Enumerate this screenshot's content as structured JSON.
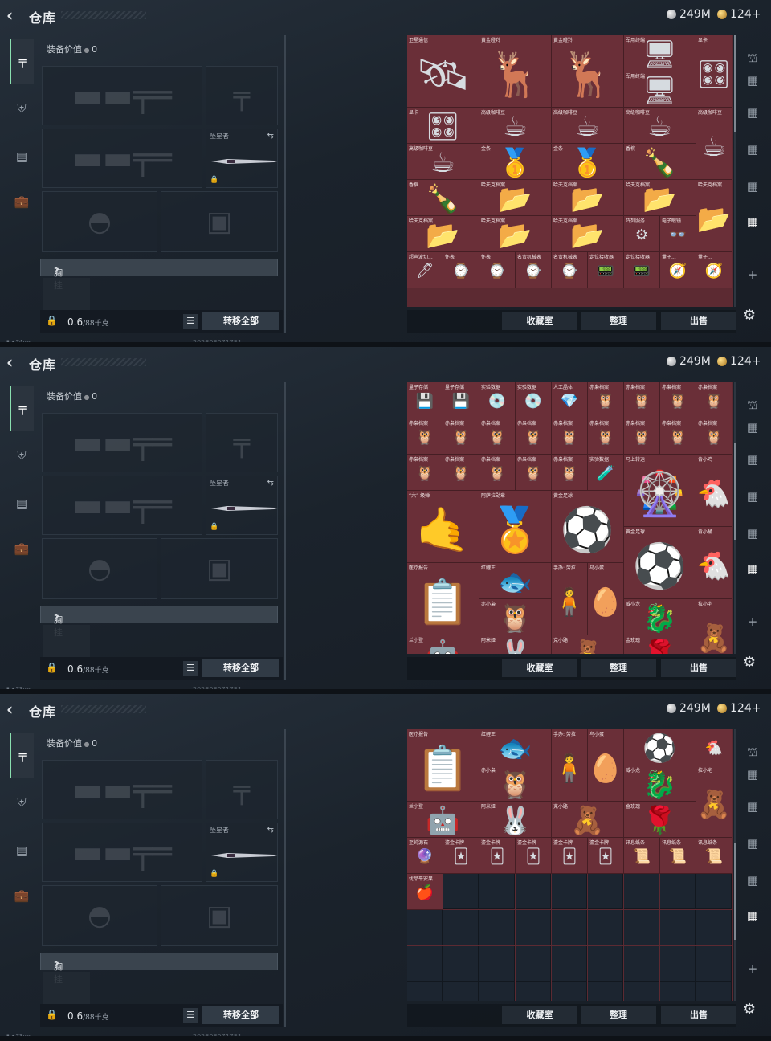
{
  "header": {
    "title": "仓库",
    "silver": "249M",
    "gold": "124+"
  },
  "sidebar": {
    "icons": [
      "pistol-icon",
      "armor-icon",
      "backpack-icon",
      "briefcase-icon"
    ]
  },
  "left_panel": {
    "equip_value_label": "装备价值",
    "equip_value": "0",
    "melee_label": "坠星者",
    "chest_label": "胸挂",
    "chest_help": "?",
    "weight": "0.6",
    "weight_max": "/88千克",
    "transfer_all": "转移全部"
  },
  "buttons": {
    "collection": "收藏室",
    "sort": "整理",
    "sell": "出售"
  },
  "screens": [
    {
      "status": "74ms",
      "stamp": "202606071751",
      "scroll": 0.0,
      "cells": [
        {
          "r": 0,
          "c": 0,
          "w": 2,
          "h": 2,
          "label": "卫星通信",
          "icon": "🛰",
          "bg": "#6a2f38"
        },
        {
          "r": 0,
          "c": 2,
          "w": 2,
          "h": 2,
          "label": "黄金瞪羚",
          "icon": "🦌",
          "bg": "#6a2f38"
        },
        {
          "r": 0,
          "c": 4,
          "w": 2,
          "h": 2,
          "label": "黄金瞪羚",
          "icon": "🦌",
          "bg": "#6a2f38"
        },
        {
          "r": 0,
          "c": 6,
          "w": 2,
          "h": 1,
          "label": "军用终端",
          "icon": "🖥",
          "bg": "#6a2f38"
        },
        {
          "r": 1,
          "c": 6,
          "w": 2,
          "h": 1,
          "label": "军用终端",
          "icon": "🖥",
          "bg": "#6a2f38"
        },
        {
          "r": 0,
          "c": 8,
          "w": 1,
          "h": 2,
          "label": "显卡",
          "icon": "🎛",
          "bg": "#6a2f38"
        },
        {
          "r": 2,
          "c": 0,
          "w": 2,
          "h": 1,
          "label": "显卡",
          "icon": "🎛",
          "bg": "#6a2f38"
        },
        {
          "r": 2,
          "c": 2,
          "w": 2,
          "h": 1,
          "label": "高级咖啡豆",
          "icon": "☕",
          "bg": "#6a2f38"
        },
        {
          "r": 2,
          "c": 4,
          "w": 2,
          "h": 1,
          "label": "高级咖啡豆",
          "icon": "☕",
          "bg": "#6a2f38"
        },
        {
          "r": 2,
          "c": 6,
          "w": 2,
          "h": 1,
          "label": "高级咖啡豆",
          "icon": "☕",
          "bg": "#6a2f38"
        },
        {
          "r": 2,
          "c": 8,
          "w": 1,
          "h": 2,
          "label": "高级咖啡豆",
          "icon": "☕",
          "bg": "#6a2f38"
        },
        {
          "r": 3,
          "c": 0,
          "w": 2,
          "h": 1,
          "label": "高级咖啡豆",
          "icon": "☕",
          "bg": "#6a2f38"
        },
        {
          "r": 3,
          "c": 2,
          "w": 2,
          "h": 1,
          "label": "金条",
          "icon": "🥇",
          "bg": "#6a2f38"
        },
        {
          "r": 3,
          "c": 4,
          "w": 2,
          "h": 1,
          "label": "金条",
          "icon": "🥇",
          "bg": "#6a2f38"
        },
        {
          "r": 3,
          "c": 6,
          "w": 2,
          "h": 1,
          "label": "香槟",
          "icon": "🍾",
          "bg": "#6a2f38"
        },
        {
          "r": 4,
          "c": 0,
          "w": 2,
          "h": 1,
          "label": "香槟",
          "icon": "🍾",
          "bg": "#6a2f38"
        },
        {
          "r": 4,
          "c": 2,
          "w": 2,
          "h": 1,
          "label": "哈夫克档案",
          "icon": "📂",
          "bg": "#6a2f38"
        },
        {
          "r": 4,
          "c": 4,
          "w": 2,
          "h": 1,
          "label": "哈夫克档案",
          "icon": "📂",
          "bg": "#6a2f38"
        },
        {
          "r": 4,
          "c": 6,
          "w": 2,
          "h": 1,
          "label": "哈夫克档案",
          "icon": "📂",
          "bg": "#6a2f38"
        },
        {
          "r": 4,
          "c": 8,
          "w": 1,
          "h": 2,
          "label": "哈夫克档案",
          "icon": "📂",
          "bg": "#6a2f38"
        },
        {
          "r": 5,
          "c": 0,
          "w": 2,
          "h": 1,
          "label": "哈夫克档案",
          "icon": "📂",
          "bg": "#6a2f38"
        },
        {
          "r": 5,
          "c": 2,
          "w": 2,
          "h": 1,
          "label": "哈夫克档案",
          "icon": "📂",
          "bg": "#6a2f38"
        },
        {
          "r": 5,
          "c": 4,
          "w": 2,
          "h": 1,
          "label": "哈夫克档案",
          "icon": "📂",
          "bg": "#6a2f38"
        },
        {
          "r": 5,
          "c": 6,
          "w": 1,
          "h": 1,
          "label": "阵列服务...",
          "icon": "⚙",
          "bg": "#6a2f38"
        },
        {
          "r": 5,
          "c": 7,
          "w": 1,
          "h": 1,
          "label": "电子眼镜",
          "icon": "👓",
          "bg": "#6a2f38"
        },
        {
          "r": 6,
          "c": 0,
          "w": 1,
          "h": 1,
          "label": "超声波切...",
          "icon": "🖊",
          "bg": "#6a2f38"
        },
        {
          "r": 6,
          "c": 1,
          "w": 1,
          "h": 1,
          "label": "怀表",
          "icon": "⌚",
          "bg": "#6a2f38"
        },
        {
          "r": 6,
          "c": 2,
          "w": 1,
          "h": 1,
          "label": "怀表",
          "icon": "⌚",
          "bg": "#6a2f38"
        },
        {
          "r": 6,
          "c": 3,
          "w": 1,
          "h": 1,
          "label": "名贵机械表",
          "icon": "⌚",
          "bg": "#6a2f38"
        },
        {
          "r": 6,
          "c": 4,
          "w": 1,
          "h": 1,
          "label": "名贵机械表",
          "icon": "⌚",
          "bg": "#6a2f38"
        },
        {
          "r": 6,
          "c": 5,
          "w": 1,
          "h": 1,
          "label": "定位接收器",
          "icon": "📟",
          "bg": "#6a2f38"
        },
        {
          "r": 6,
          "c": 6,
          "w": 1,
          "h": 1,
          "label": "定位接收器",
          "icon": "📟",
          "bg": "#6a2f38"
        },
        {
          "r": 6,
          "c": 7,
          "w": 1,
          "h": 1,
          "label": "量子...",
          "icon": "🧭",
          "bg": "#6a2f38"
        },
        {
          "r": 6,
          "c": 8,
          "w": 1,
          "h": 1,
          "label": "量子...",
          "icon": "🧭",
          "bg": "#6a2f38"
        }
      ]
    },
    {
      "status": "73ms",
      "stamp": "202606071751",
      "scroll": 0.35,
      "cells": [
        {
          "r": 0,
          "c": 0,
          "w": 1,
          "h": 1,
          "label": "量子存储",
          "icon": "💾",
          "bg": "#6a2f38"
        },
        {
          "r": 0,
          "c": 1,
          "w": 1,
          "h": 1,
          "label": "量子存储",
          "icon": "💾",
          "bg": "#6a2f38"
        },
        {
          "r": 0,
          "c": 2,
          "w": 1,
          "h": 1,
          "label": "实验数据",
          "icon": "💿",
          "bg": "#6a2f38"
        },
        {
          "r": 0,
          "c": 3,
          "w": 1,
          "h": 1,
          "label": "实验数据",
          "icon": "💿",
          "bg": "#6a2f38"
        },
        {
          "r": 0,
          "c": 4,
          "w": 1,
          "h": 1,
          "label": "人工晶体",
          "icon": "💎",
          "bg": "#6a2f38"
        },
        {
          "r": 0,
          "c": 5,
          "w": 1,
          "h": 1,
          "label": "赤枭档案",
          "icon": "🦉",
          "bg": "#6a2f38"
        },
        {
          "r": 0,
          "c": 6,
          "w": 1,
          "h": 1,
          "label": "赤枭档案",
          "icon": "🦉",
          "bg": "#6a2f38"
        },
        {
          "r": 0,
          "c": 7,
          "w": 1,
          "h": 1,
          "label": "赤枭档案",
          "icon": "🦉",
          "bg": "#6a2f38"
        },
        {
          "r": 0,
          "c": 8,
          "w": 1,
          "h": 1,
          "label": "赤枭档案",
          "icon": "🦉",
          "bg": "#6a2f38"
        },
        {
          "r": 1,
          "c": 0,
          "w": 1,
          "h": 1,
          "label": "赤枭档案",
          "icon": "🦉",
          "bg": "#6a2f38"
        },
        {
          "r": 1,
          "c": 1,
          "w": 1,
          "h": 1,
          "label": "赤枭档案",
          "icon": "🦉",
          "bg": "#6a2f38"
        },
        {
          "r": 1,
          "c": 2,
          "w": 1,
          "h": 1,
          "label": "赤枭档案",
          "icon": "🦉",
          "bg": "#6a2f38"
        },
        {
          "r": 1,
          "c": 3,
          "w": 1,
          "h": 1,
          "label": "赤枭档案",
          "icon": "🦉",
          "bg": "#6a2f38"
        },
        {
          "r": 1,
          "c": 4,
          "w": 1,
          "h": 1,
          "label": "赤枭档案",
          "icon": "🦉",
          "bg": "#6a2f38"
        },
        {
          "r": 1,
          "c": 5,
          "w": 1,
          "h": 1,
          "label": "赤枭档案",
          "icon": "🦉",
          "bg": "#6a2f38"
        },
        {
          "r": 1,
          "c": 6,
          "w": 1,
          "h": 1,
          "label": "赤枭档案",
          "icon": "🦉",
          "bg": "#6a2f38"
        },
        {
          "r": 1,
          "c": 7,
          "w": 1,
          "h": 1,
          "label": "赤枭档案",
          "icon": "🦉",
          "bg": "#6a2f38"
        },
        {
          "r": 1,
          "c": 8,
          "w": 1,
          "h": 1,
          "label": "赤枭档案",
          "icon": "🦉",
          "bg": "#6a2f38"
        },
        {
          "r": 2,
          "c": 0,
          "w": 1,
          "h": 1,
          "label": "赤枭档案",
          "icon": "🦉",
          "bg": "#6a2f38"
        },
        {
          "r": 2,
          "c": 1,
          "w": 1,
          "h": 1,
          "label": "赤枭档案",
          "icon": "🦉",
          "bg": "#6a2f38"
        },
        {
          "r": 2,
          "c": 2,
          "w": 1,
          "h": 1,
          "label": "赤枭档案",
          "icon": "🦉",
          "bg": "#6a2f38"
        },
        {
          "r": 2,
          "c": 3,
          "w": 1,
          "h": 1,
          "label": "赤枭档案",
          "icon": "🦉",
          "bg": "#6a2f38"
        },
        {
          "r": 2,
          "c": 4,
          "w": 1,
          "h": 1,
          "label": "赤枭档案",
          "icon": "🦉",
          "bg": "#6a2f38"
        },
        {
          "r": 2,
          "c": 5,
          "w": 1,
          "h": 1,
          "label": "实验数据",
          "icon": "🧪",
          "bg": "#6a2f38"
        },
        {
          "r": 2,
          "c": 6,
          "w": 2,
          "h": 2,
          "label": "马上转运",
          "icon": "🎡",
          "bg": "#6a2f38"
        },
        {
          "r": 2,
          "c": 8,
          "w": 1,
          "h": 2,
          "label": "肯小鸡",
          "icon": "🐔",
          "bg": "#6a2f38"
        },
        {
          "r": 3,
          "c": 0,
          "w": 2,
          "h": 2,
          "label": "“六” 级弹",
          "icon": "🤙",
          "bg": "#6a2f38"
        },
        {
          "r": 3,
          "c": 2,
          "w": 2,
          "h": 2,
          "label": "阿萨拉勋章",
          "icon": "🏅",
          "bg": "#6a2f38"
        },
        {
          "r": 3,
          "c": 4,
          "w": 2,
          "h": 2,
          "label": "黄金足球",
          "icon": "⚽",
          "bg": "#6a2f38"
        },
        {
          "r": 4,
          "c": 6,
          "w": 2,
          "h": 2,
          "label": "黄金足球",
          "icon": "⚽",
          "bg": "#6a2f38"
        },
        {
          "r": 4,
          "c": 8,
          "w": 1,
          "h": 2,
          "label": "肯小桶",
          "icon": "🐔",
          "bg": "#6a2f38"
        },
        {
          "r": 5,
          "c": 0,
          "w": 2,
          "h": 2,
          "label": "医疗报告",
          "icon": "📋",
          "bg": "#6a2f38"
        },
        {
          "r": 5,
          "c": 2,
          "w": 2,
          "h": 1,
          "label": "红鲤王",
          "icon": "🐟",
          "bg": "#6a2f38"
        },
        {
          "r": 5,
          "c": 4,
          "w": 1,
          "h": 2,
          "label": "手办: 劳拉",
          "icon": "🧍",
          "bg": "#6a2f38"
        },
        {
          "r": 5,
          "c": 5,
          "w": 1,
          "h": 2,
          "label": "乌小蛋",
          "icon": "🥚",
          "bg": "#6a2f38"
        },
        {
          "r": 6,
          "c": 2,
          "w": 2,
          "h": 1,
          "label": "赤小枭",
          "icon": "🦉",
          "bg": "#6a2f38"
        },
        {
          "r": 6,
          "c": 6,
          "w": 2,
          "h": 1,
          "label": "威小龙",
          "icon": "🐉",
          "bg": "#6a2f38"
        },
        {
          "r": 6,
          "c": 8,
          "w": 1,
          "h": 2,
          "label": "拉小宅",
          "icon": "🧸",
          "bg": "#6a2f38"
        },
        {
          "r": 7,
          "c": 0,
          "w": 2,
          "h": 1,
          "label": "兰小登",
          "icon": "🤖",
          "bg": "#6a2f38"
        },
        {
          "r": 7,
          "c": 2,
          "w": 2,
          "h": 1,
          "label": "阿米娅",
          "icon": "🐰",
          "bg": "#6a2f38"
        },
        {
          "r": 7,
          "c": 4,
          "w": 2,
          "h": 1,
          "label": "克小路",
          "icon": "🧸",
          "bg": "#6a2f38"
        },
        {
          "r": 7,
          "c": 6,
          "w": 2,
          "h": 1,
          "label": "金玫瑰",
          "icon": "🌹",
          "bg": "#6a2f38"
        }
      ]
    },
    {
      "status": "73ms",
      "stamp": "202606071751",
      "scroll": 0.65,
      "cells": [
        {
          "r": 0,
          "c": 0,
          "w": 2,
          "h": 2,
          "label": "医疗报告",
          "icon": "📋",
          "bg": "#6a2f38"
        },
        {
          "r": 0,
          "c": 2,
          "w": 2,
          "h": 1,
          "label": "红鲤王",
          "icon": "🐟",
          "bg": "#6a2f38"
        },
        {
          "r": 0,
          "c": 4,
          "w": 1,
          "h": 2,
          "label": "手办: 劳拉",
          "icon": "🧍",
          "bg": "#6a2f38"
        },
        {
          "r": 0,
          "c": 5,
          "w": 1,
          "h": 2,
          "label": "乌小蛋",
          "icon": "🥚",
          "bg": "#6a2f38"
        },
        {
          "r": 0,
          "c": 6,
          "w": 2,
          "h": 1,
          "label": "",
          "icon": "⚽",
          "bg": "#6a2f38"
        },
        {
          "r": 0,
          "c": 8,
          "w": 1,
          "h": 1,
          "label": "",
          "icon": "🐔",
          "bg": "#6a2f38"
        },
        {
          "r": 1,
          "c": 2,
          "w": 2,
          "h": 1,
          "label": "赤小枭",
          "icon": "🦉",
          "bg": "#6a2f38"
        },
        {
          "r": 1,
          "c": 6,
          "w": 2,
          "h": 1,
          "label": "威小龙",
          "icon": "🐉",
          "bg": "#6a2f38"
        },
        {
          "r": 1,
          "c": 8,
          "w": 1,
          "h": 2,
          "label": "拉小宅",
          "icon": "🧸",
          "bg": "#6a2f38"
        },
        {
          "r": 2,
          "c": 0,
          "w": 2,
          "h": 1,
          "label": "兰小登",
          "icon": "🤖",
          "bg": "#6a2f38"
        },
        {
          "r": 2,
          "c": 2,
          "w": 2,
          "h": 1,
          "label": "阿米娅",
          "icon": "🐰",
          "bg": "#6a2f38"
        },
        {
          "r": 2,
          "c": 4,
          "w": 2,
          "h": 1,
          "label": "克小路",
          "icon": "🧸",
          "bg": "#6a2f38"
        },
        {
          "r": 2,
          "c": 6,
          "w": 2,
          "h": 1,
          "label": "金玫瑰",
          "icon": "🌹",
          "bg": "#6a2f38"
        },
        {
          "r": 3,
          "c": 0,
          "w": 1,
          "h": 1,
          "label": "至纯源石",
          "icon": "🔮",
          "bg": "#6a2f38"
        },
        {
          "r": 3,
          "c": 1,
          "w": 1,
          "h": 1,
          "label": "鎏金卡牌",
          "icon": "🃏",
          "bg": "#6a2f38"
        },
        {
          "r": 3,
          "c": 2,
          "w": 1,
          "h": 1,
          "label": "鎏金卡牌",
          "icon": "🃏",
          "bg": "#6a2f38"
        },
        {
          "r": 3,
          "c": 3,
          "w": 1,
          "h": 1,
          "label": "鎏金卡牌",
          "icon": "🃏",
          "bg": "#6a2f38"
        },
        {
          "r": 3,
          "c": 4,
          "w": 1,
          "h": 1,
          "label": "鎏金卡牌",
          "icon": "🃏",
          "bg": "#6a2f38"
        },
        {
          "r": 3,
          "c": 5,
          "w": 1,
          "h": 1,
          "label": "鎏金卡牌",
          "icon": "🃏",
          "bg": "#6a2f38"
        },
        {
          "r": 3,
          "c": 6,
          "w": 1,
          "h": 1,
          "label": "讯息纸条",
          "icon": "📜",
          "bg": "#6a2f38"
        },
        {
          "r": 3,
          "c": 7,
          "w": 1,
          "h": 1,
          "label": "讯息纸条",
          "icon": "📜",
          "bg": "#6a2f38"
        },
        {
          "r": 3,
          "c": 8,
          "w": 1,
          "h": 1,
          "label": "讯息纸条",
          "icon": "📜",
          "bg": "#6a2f38"
        },
        {
          "r": 4,
          "c": 0,
          "w": 1,
          "h": 1,
          "label": "优品平安果",
          "icon": "🍎",
          "bg": "#6a2f38"
        }
      ]
    }
  ],
  "colors": {
    "rarity_red": "#6a2f38",
    "accent_green": "#8ae0b0",
    "empty_slot": "#1c2530"
  }
}
